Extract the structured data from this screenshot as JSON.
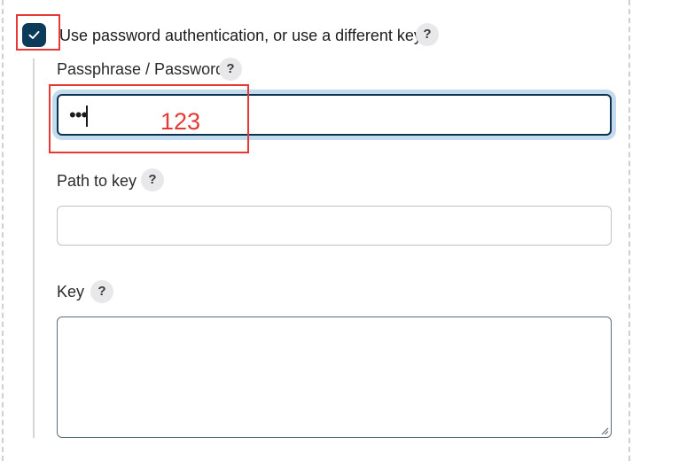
{
  "checkbox": {
    "label": "Use password authentication, or use a different key",
    "checked": true
  },
  "help_icon_glyph": "?",
  "fields": {
    "passphrase": {
      "label": "Passphrase / Password",
      "masked_value": "•••"
    },
    "path_to_key": {
      "label": "Path to key",
      "value": ""
    },
    "key": {
      "label": "Key",
      "value": ""
    }
  },
  "annotation": {
    "text": "123",
    "color": "#e53935"
  },
  "colors": {
    "checkbox_fill": "#0b3a5b",
    "focus_ring": "#c4dbee",
    "focus_border": "#0c3450"
  }
}
